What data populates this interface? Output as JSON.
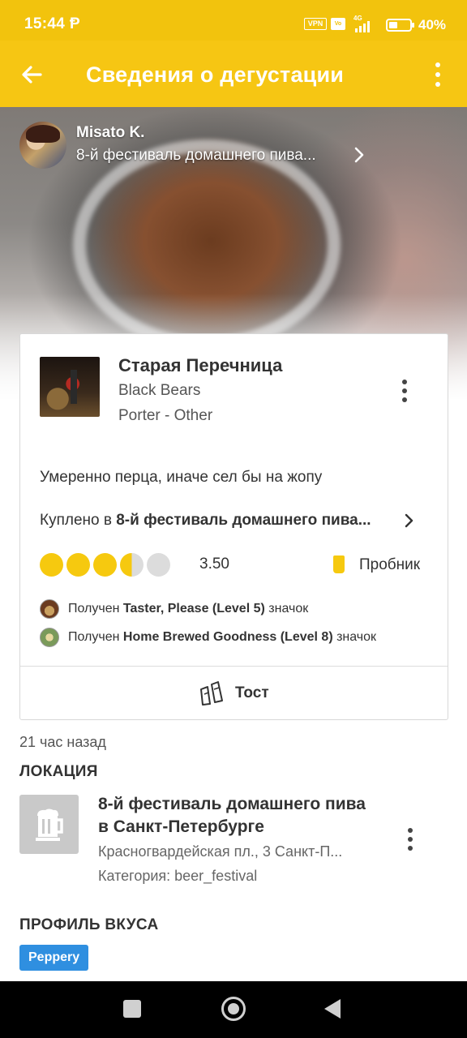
{
  "status_bar": {
    "time": "15:44",
    "notification_icon": "p-icon",
    "vpn": "VPN",
    "volte": "Vo LTE",
    "network": "4G",
    "battery": "40%"
  },
  "app_bar": {
    "title": "Сведения о дегустации",
    "back_icon": "arrow-left-icon",
    "menu_icon": "more-vertical-icon"
  },
  "checkin": {
    "user_name": "Misato K.",
    "venue_link": "8-й фестиваль домашнего пива..."
  },
  "beer": {
    "name": "Старая Перечница",
    "brewery": "Black Bears",
    "style": "Porter - Other",
    "comment": "Умеренно перца, иначе сел бы на жопу",
    "purchased_prefix": "Куплено в ",
    "purchased_place": "8-й фестиваль домашнего пива...",
    "rating": 3.5,
    "rating_text": "3.50",
    "rating_max": 5,
    "serving": "Пробник"
  },
  "badges": [
    {
      "prefix": "Получен ",
      "name": "Taster, Please (Level 5)",
      "suffix": " значок"
    },
    {
      "prefix": "Получен ",
      "name": "Home Brewed Goodness (Level 8)",
      "suffix": " значок"
    }
  ],
  "toast": {
    "label": "Тост"
  },
  "time_ago": "21 час назад",
  "location": {
    "section_title": "ЛОКАЦИЯ",
    "name": "8-й фестиваль домашнего пива в Санкт-Петербурге",
    "address": "Красногвардейская пл., 3 Санкт-П...",
    "category": "Категория: beer_festival"
  },
  "flavor_profile": {
    "section_title": "ПРОФИЛЬ ВКУСА",
    "tags": [
      "Peppery"
    ]
  },
  "colors": {
    "accent": "#f6c613",
    "rating_cap": "#f6c90f",
    "tag_blue": "#2f8fe0"
  }
}
